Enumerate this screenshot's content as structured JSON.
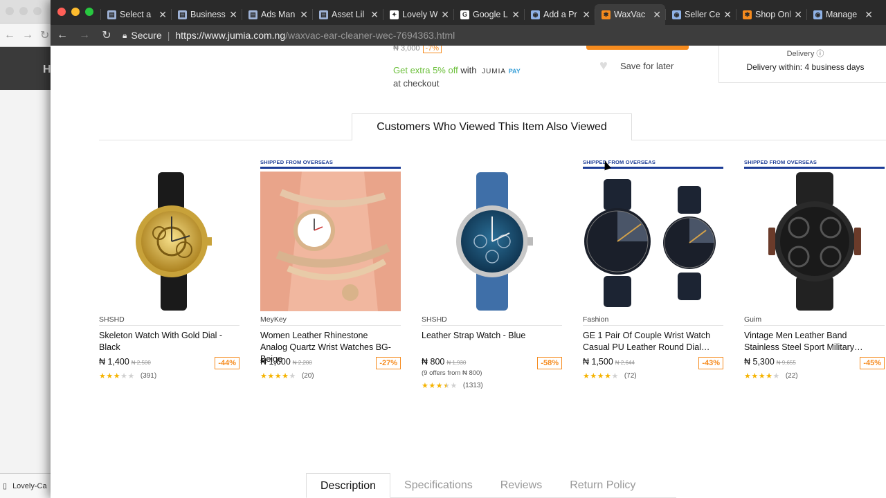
{
  "background_window": {
    "header_fragment": "H",
    "download_filename": "Lovely-Ca"
  },
  "browser": {
    "tabs": [
      {
        "title": "Select a",
        "icon": "doc-icon",
        "active": false
      },
      {
        "title": "Business",
        "icon": "doc-icon",
        "active": false
      },
      {
        "title": "Ads Man",
        "icon": "doc-icon",
        "active": false
      },
      {
        "title": "Asset Lil",
        "icon": "doc-icon",
        "active": false
      },
      {
        "title": "Lovely W",
        "icon": "lovely-icon",
        "active": false
      },
      {
        "title": "Google L",
        "icon": "google-icon",
        "active": false
      },
      {
        "title": "Add a Pr",
        "icon": "globe-icon",
        "active": false
      },
      {
        "title": "WaxVac",
        "icon": "jumia-icon",
        "active": true
      },
      {
        "title": "Seller Ce",
        "icon": "globe-icon",
        "active": false
      },
      {
        "title": "Shop Onl",
        "icon": "jumia-icon",
        "active": false
      },
      {
        "title": "Manage",
        "icon": "globe-icon",
        "active": false
      }
    ],
    "secure_label": "Secure",
    "url_host": "https://www.jumia.com.ng",
    "url_path": "/waxvac-ear-cleaner-wec-7694363.html"
  },
  "page": {
    "price_fragment": "₦ 3,000",
    "price_fragment_pct": "-7%",
    "extra_green": "Get extra 5% off",
    "extra_with": "with",
    "extra_brand": "JUMIA",
    "extra_pay": "PAY",
    "extra_checkout": "at checkout",
    "save_for_later": "Save for later",
    "delivery_title": "Delivery ⓘ",
    "delivery_text": "Delivery within: 4 business days",
    "section_title": "Customers Who Viewed This Item Also Viewed",
    "products": [
      {
        "shipped": "",
        "brand": "SHSHD",
        "name": "Skeleton Watch With Gold Dial - Black",
        "price": "₦ 1,400",
        "old_price": "₦ 2,500",
        "offers": "",
        "discount": "-44%",
        "rating": 3,
        "reviews": "(391)"
      },
      {
        "shipped": "SHIPPED FROM OVERSEAS",
        "brand": "MeyKey",
        "name": "Women Leather Rhinestone Analog Quartz Wrist Watches BG- Beige",
        "price": "₦ 1,600",
        "old_price": "₦ 2,200",
        "offers": "",
        "discount": "-27%",
        "rating": 4,
        "reviews": "(20)"
      },
      {
        "shipped": "",
        "brand": "SHSHD",
        "name": "Leather Strap Watch - Blue",
        "price": "₦ 800",
        "old_price": "₦ 1,930",
        "offers": "(9 offers from ₦ 800)",
        "discount": "-58%",
        "rating": 3.5,
        "reviews": "(1313)"
      },
      {
        "shipped": "SHIPPED FROM OVERSEAS",
        "brand": "Fashion",
        "name": "GE 1 Pair Of Couple Wrist Watch Casual PU Leather Round Dial…",
        "price": "₦ 1,500",
        "old_price": "₦ 2,644",
        "offers": "",
        "discount": "-43%",
        "rating": 4,
        "reviews": "(72)"
      },
      {
        "shipped": "SHIPPED FROM OVERSEAS",
        "brand": "Guim",
        "name": "Vintage Men Leather Band Stainless Steel Sport Military…",
        "price": "₦ 5,300",
        "old_price": "₦ 9,655",
        "offers": "",
        "discount": "-45%",
        "rating": 4,
        "reviews": "(22)"
      }
    ],
    "detail_tabs": [
      {
        "label": "Description",
        "active": true
      },
      {
        "label": "Specifications",
        "active": false
      },
      {
        "label": "Reviews",
        "active": false
      },
      {
        "label": "Return Policy",
        "active": false
      }
    ]
  },
  "colors": {
    "accent_orange": "#f68b1e",
    "shipped_blue": "#1c3c96",
    "star": "#f5b301"
  }
}
